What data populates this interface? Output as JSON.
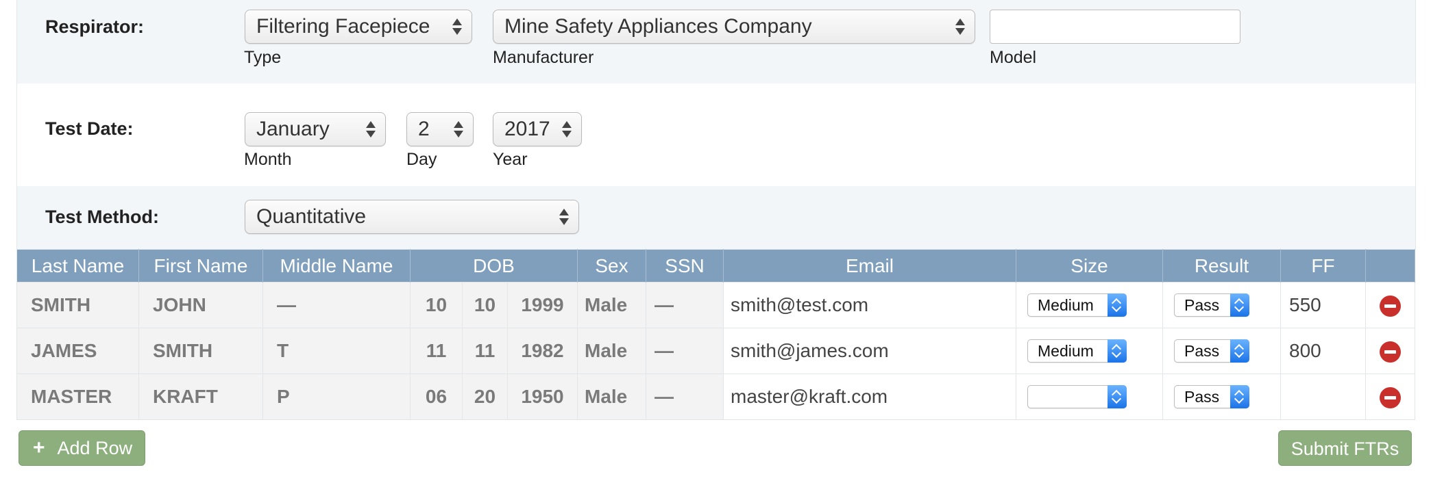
{
  "respirator": {
    "label": "Respirator:",
    "type": {
      "value": "Filtering Facepiece",
      "caption": "Type"
    },
    "manufacturer": {
      "value": "Mine Safety Appliances Company",
      "caption": "Manufacturer"
    },
    "model": {
      "value": "",
      "caption": "Model"
    }
  },
  "test_date": {
    "label": "Test Date:",
    "month": {
      "value": "January",
      "caption": "Month"
    },
    "day": {
      "value": "2",
      "caption": "Day"
    },
    "year": {
      "value": "2017",
      "caption": "Year"
    }
  },
  "test_method": {
    "label": "Test Method:",
    "value": "Quantitative"
  },
  "table": {
    "headers": [
      "Last Name",
      "First Name",
      "Middle Name",
      "DOB",
      "Sex",
      "SSN",
      "Email",
      "Size",
      "Result",
      "FF",
      ""
    ],
    "rows": [
      {
        "last": "SMITH",
        "first": "JOHN",
        "middle": "—",
        "dob_month": "10",
        "dob_day": "10",
        "dob_year": "1999",
        "sex": "Male",
        "ssn": "—",
        "email": "smith@test.com",
        "size": "Medium",
        "result": "Pass",
        "ff": "550"
      },
      {
        "last": "JAMES",
        "first": "SMITH",
        "middle": "T",
        "dob_month": "11",
        "dob_day": "11",
        "dob_year": "1982",
        "sex": "Male",
        "ssn": "—",
        "email": "smith@james.com",
        "size": "Medium",
        "result": "Pass",
        "ff": "800"
      },
      {
        "last": "MASTER",
        "first": "KRAFT",
        "middle": "P",
        "dob_month": "06",
        "dob_day": "20",
        "dob_year": "1950",
        "sex": "Male",
        "ssn": "—",
        "email": "master@kraft.com",
        "size": "",
        "result": "Pass",
        "ff": ""
      }
    ]
  },
  "buttons": {
    "add_row_icon": "+",
    "add_row": "Add Row",
    "submit": "Submit FTRs"
  },
  "colors": {
    "header_bg": "#7f9fbd",
    "button_green": "#8daf7e",
    "remove_red": "#c9302c",
    "select_blue": "#1a73e8"
  }
}
